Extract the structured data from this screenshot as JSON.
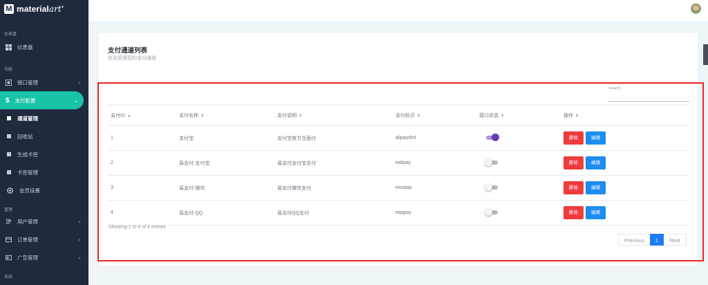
{
  "brand": {
    "name": "material",
    "suffix": "art"
  },
  "sidebar": {
    "sections": [
      "仪表盘",
      "功能",
      "管理",
      "系统"
    ],
    "dashboard": "仪表盘",
    "items": [
      {
        "label": "接口管理",
        "icon": "api-icon"
      },
      {
        "label": "支付配置",
        "icon": "dollar-icon",
        "active": true
      },
      {
        "label": "用户管理",
        "icon": "users-icon"
      },
      {
        "label": "订单管理",
        "icon": "orders-icon"
      },
      {
        "label": "广告管理",
        "icon": "ad-icon"
      }
    ],
    "subitems": [
      "通道管理",
      "回收站",
      "生成卡密",
      "卡密管理",
      "会员设置"
    ]
  },
  "card": {
    "title": "支付通道列表",
    "subtitle": "在此管理您的支付通道"
  },
  "search": {
    "label": "Search",
    "value": ""
  },
  "table": {
    "headers": [
      "支付ID",
      "支付名称",
      "支付说明",
      "支付标识",
      "接口状态",
      "操作"
    ],
    "sort_icons": [
      "▲",
      "⬍",
      "⬍",
      "⬍",
      "⬍",
      "⬍"
    ],
    "rows": [
      {
        "id": "1",
        "name": "支付宝",
        "desc": "支付宝官方当面付",
        "code": "alipaydmf",
        "enabled": true
      },
      {
        "id": "2",
        "name": "易支付-支付宝",
        "desc": "易支付支付宝支付",
        "code": "ealipay",
        "enabled": false
      },
      {
        "id": "3",
        "name": "易支付-微信",
        "desc": "易支付微信支付",
        "code": "ewxpay",
        "enabled": false
      },
      {
        "id": "4",
        "name": "易支付-QQ",
        "desc": "易支付QQ支付",
        "code": "eqqpay",
        "enabled": false
      }
    ],
    "delete_label": "删除",
    "edit_label": "编辑"
  },
  "footer": {
    "info": "Showing 1 to 4 of 4 entries",
    "prev": "Previous",
    "page": "1",
    "next": "Next"
  },
  "colors": {
    "sidebar_bg": "#1f2a3d",
    "accent": "#19c3a6",
    "delete": "#ef3b3b",
    "edit": "#1d8df0",
    "toggle_on": "#673ab7",
    "highlight": "#e8231f"
  }
}
